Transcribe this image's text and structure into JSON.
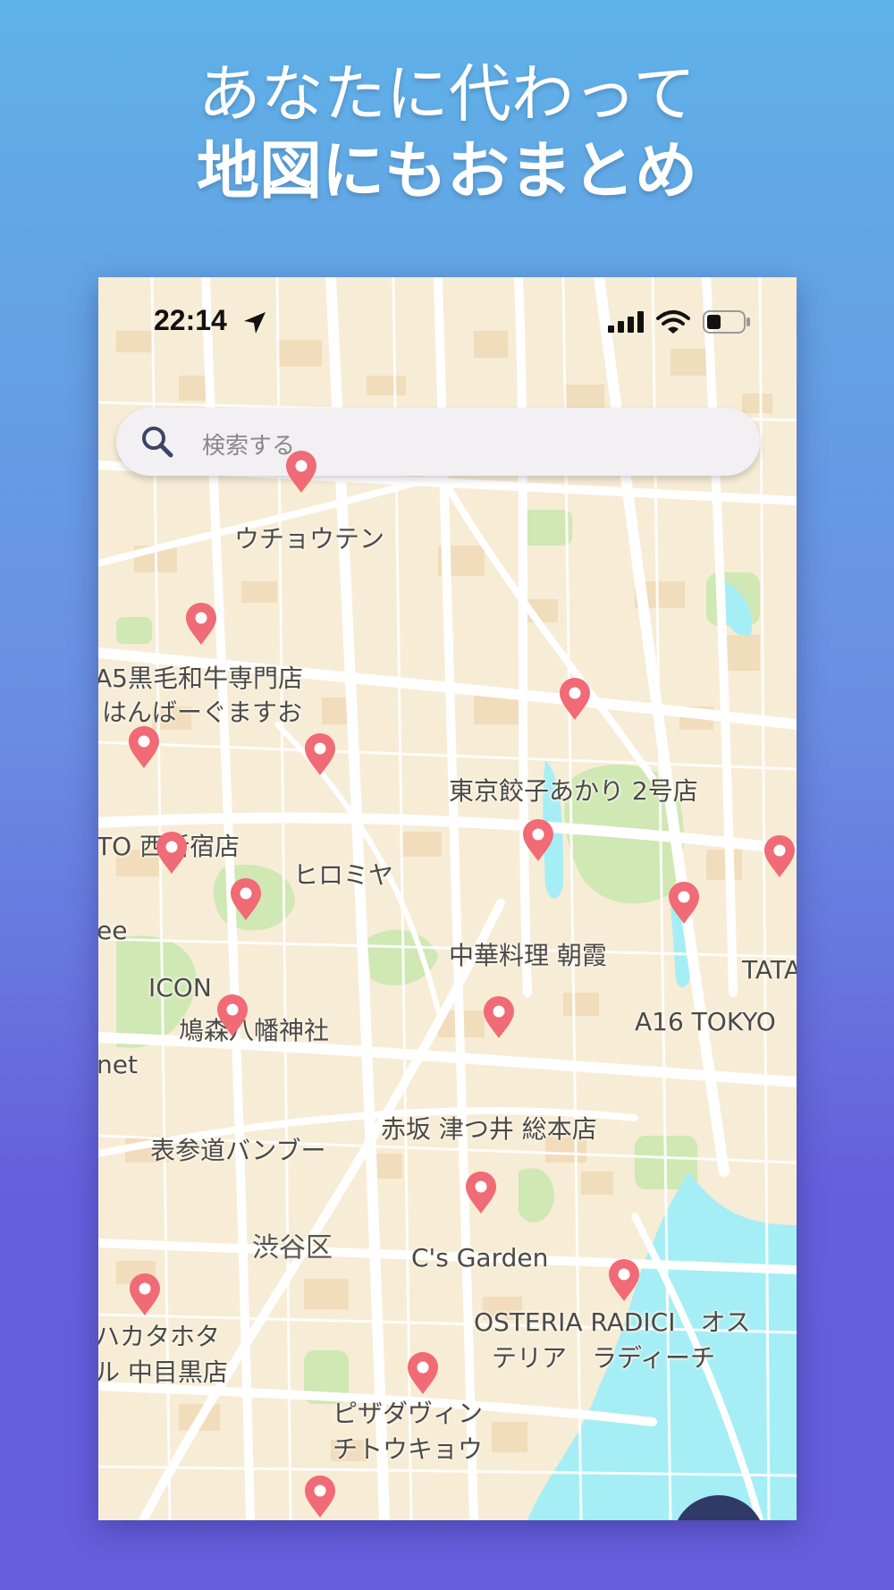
{
  "headline": {
    "line1": "あなたに代わって",
    "line2": "地図にもおまとめ"
  },
  "status_bar": {
    "time": "22:14",
    "icons": [
      "location-arrow-icon",
      "signal-icon",
      "wifi-icon",
      "battery-icon"
    ]
  },
  "search": {
    "placeholder": "検索する",
    "icon": "search-icon"
  },
  "places": [
    {
      "name": "ウチョウテン"
    },
    {
      "name": "A5黒毛和牛専門店"
    },
    {
      "name": "はんばーぐますお"
    },
    {
      "name": "東京餃子あかり 2号店"
    },
    {
      "name": "TO 西新宿店"
    },
    {
      "name": "ヒロミヤ"
    },
    {
      "name": "ee"
    },
    {
      "name": "中華料理 朝霞"
    },
    {
      "name": "TATA"
    },
    {
      "name": "ICON"
    },
    {
      "name": "A16 TOKYO"
    },
    {
      "name": "鳩森八幡神社"
    },
    {
      "name": "net"
    },
    {
      "name": "赤坂 津つ井 総本店"
    },
    {
      "name": "表参道バンブー"
    },
    {
      "name": "C's Garden"
    },
    {
      "name": "ハカタホタ"
    },
    {
      "name": "ル 中目黒店"
    },
    {
      "name": "OSTERIA RADICI　オス"
    },
    {
      "name": "テリア　ラディーチ"
    },
    {
      "name": "ピザダヴィン"
    },
    {
      "name": "チトウキョウ"
    }
  ],
  "areas": [
    {
      "name": "渋谷区"
    }
  ],
  "colors": {
    "map_land": "#f7ecd6",
    "map_road": "#ffffff",
    "map_park": "#cfe8b4",
    "map_water": "#a6eef5",
    "pin": "#f06b76",
    "search_bg": "#f2f0f3",
    "fab": "#2f3a67"
  }
}
